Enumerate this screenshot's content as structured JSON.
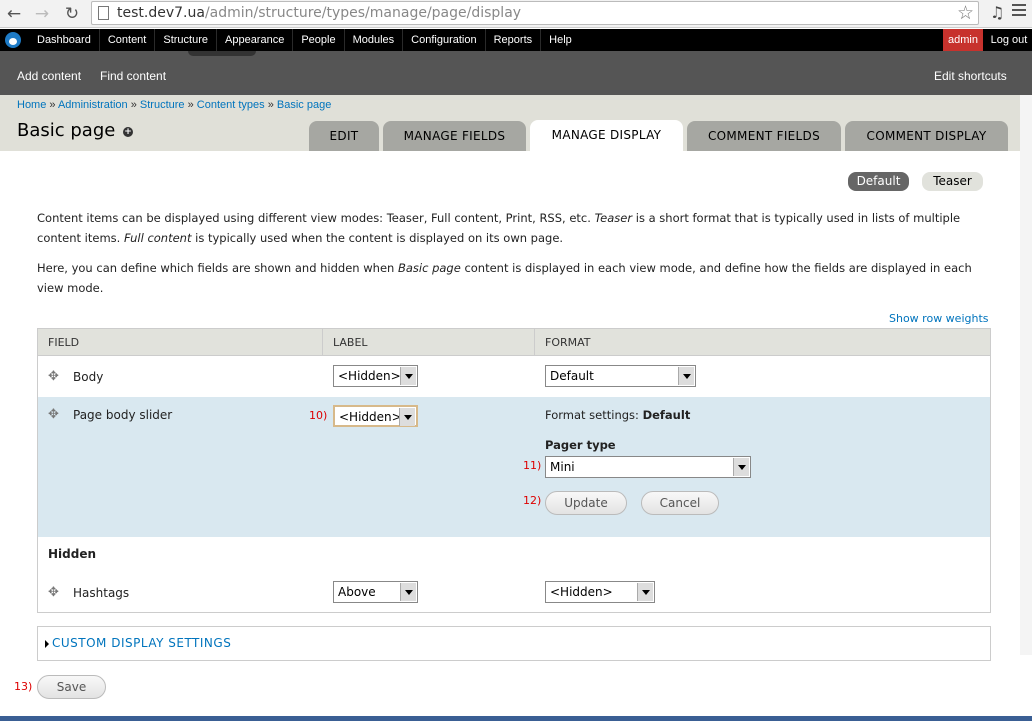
{
  "browser": {
    "url_host": "test.dev7.ua",
    "url_path": "/admin/structure/types/manage/page/display"
  },
  "toolbar": {
    "items": [
      "Dashboard",
      "Content",
      "Structure",
      "Appearance",
      "People",
      "Modules",
      "Configuration",
      "Reports",
      "Help"
    ],
    "user": "admin",
    "logout": "Log out"
  },
  "shortcuts": {
    "add_content": "Add content",
    "find_content": "Find content",
    "edit_shortcuts": "Edit shortcuts"
  },
  "breadcrumb": [
    "Home",
    "Administration",
    "Structure",
    "Content types",
    "Basic page"
  ],
  "breadcrumb_sep": "»",
  "page_title": "Basic page",
  "tabs": [
    "EDIT",
    "MANAGE FIELDS",
    "MANAGE DISPLAY",
    "COMMENT FIELDS",
    "COMMENT DISPLAY"
  ],
  "active_tab": "MANAGE DISPLAY",
  "view_modes": {
    "default": "Default",
    "teaser": "Teaser"
  },
  "description": {
    "p1_a": "Content items can be displayed using different view modes: Teaser, Full content, Print, RSS, etc. ",
    "p1_teaser": "Teaser",
    "p1_b": " is a short format that is typically used in lists of multiple",
    "p1_c": "content items. ",
    "p1_full": "Full content",
    "p1_d": " is typically used when the content is displayed on its own page.",
    "p2_a": "Here, you can define which fields are shown and hidden when ",
    "p2_type": "Basic page",
    "p2_b": " content is displayed in each view mode, and define how the fields are displayed in each",
    "p2_c": "view mode."
  },
  "show_row_weights": "Show row weights",
  "table": {
    "headers": {
      "field": "FIELD",
      "label": "LABEL",
      "format": "FORMAT"
    },
    "rows": {
      "body": {
        "name": "Body",
        "label": "<Hidden>",
        "format": "Default"
      },
      "slider": {
        "name": "Page body slider",
        "label": "<Hidden>",
        "format_settings_prefix": "Format settings:",
        "format_settings_value": "Default",
        "pager_type_label": "Pager type",
        "pager_type_value": "Mini",
        "update": "Update",
        "cancel": "Cancel"
      },
      "hidden_region": "Hidden",
      "hashtags": {
        "name": "Hashtags",
        "label": "Above",
        "format": "<Hidden>"
      }
    }
  },
  "annotations": {
    "n10": "10)",
    "n11": "11)",
    "n12": "12)",
    "n13": "13)"
  },
  "custom_display_settings": "CUSTOM DISPLAY SETTINGS",
  "save": "Save"
}
